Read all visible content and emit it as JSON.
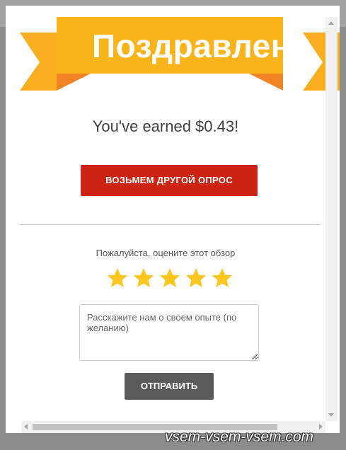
{
  "banner": {
    "title": "Поздравлени",
    "colors": {
      "ribbon_main": "#f9b41b",
      "ribbon_fold": "#f08425",
      "ribbon_tail": "#f9ad1f"
    }
  },
  "reward": {
    "earned_text": "You've earned $0.43!"
  },
  "actions": {
    "another_survey_label": "ВОЗЬМЕМ ДРУГОЙ ОПРОС",
    "another_survey_color": "#cc2313"
  },
  "rating": {
    "prompt": "Пожалуйста, оцените этот обзор",
    "max_stars": 5,
    "filled_stars": 5,
    "star_color": "#fcc61f"
  },
  "feedback": {
    "placeholder": "Расскажите нам о своем опыте (по желанию)",
    "value": ""
  },
  "submit": {
    "label": "ОТПРАВИТЬ",
    "color": "#5a5a5a"
  },
  "watermark": {
    "text": "vsem-vsem-vsem.com"
  }
}
